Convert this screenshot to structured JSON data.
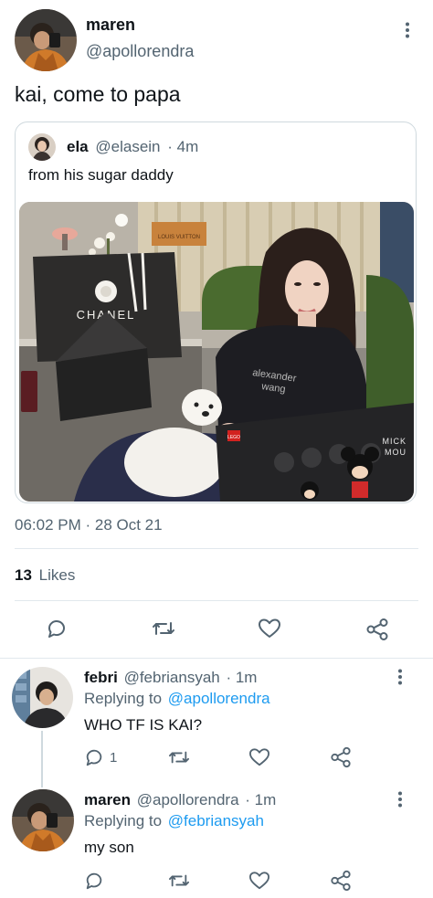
{
  "main_tweet": {
    "author_name": "maren",
    "author_handle": "@apollorendra",
    "text": "kai, come to papa",
    "timestamp": "06:02 PM · 28 Oct 21",
    "likes_count": "13",
    "likes_label": "Likes"
  },
  "quoted_tweet": {
    "author_name": "ela",
    "author_handle": "@elasein",
    "time": "· 4m",
    "text": "from his sugar daddy",
    "photo_labels": {
      "chanel": "CHANEL",
      "louis_vuitton": "LOUIS VUITTON",
      "shirt_line1": "alexander",
      "shirt_line2": "wang",
      "box_line1": "MICK",
      "box_line2": "MOU",
      "lego": "LEGO"
    }
  },
  "replies": [
    {
      "author_name": "febri",
      "author_handle": "@febriansyah",
      "time": "· 1m",
      "replying_prefix": "Replying to",
      "replying_handle": "@apollorendra",
      "text": "WHO TF IS KAI?",
      "reply_count": "1"
    },
    {
      "author_name": "maren",
      "author_handle": "@apollorendra",
      "time": "· 1m",
      "replying_prefix": "Replying to",
      "replying_handle": "@febriansyah",
      "text": "my son",
      "reply_count": ""
    }
  ],
  "colors": {
    "text": "#0f1419",
    "muted": "#536471",
    "link": "#1d9bf0",
    "border": "#cfd9de"
  },
  "icons": [
    "more-vertical-icon",
    "reply-icon",
    "retweet-icon",
    "like-icon",
    "share-icon"
  ]
}
